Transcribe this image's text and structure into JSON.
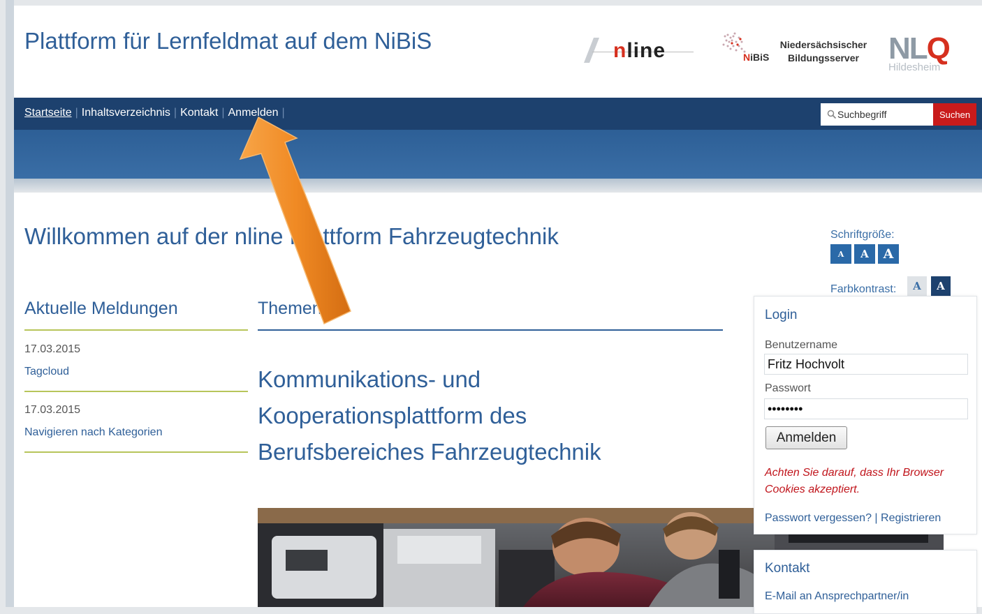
{
  "header": {
    "site_title": "Plattform für Lernfeldmat auf dem NiBiS",
    "logos": {
      "nline": "nline",
      "nibis": "NiBiS",
      "nds_line1": "Niedersächsischer",
      "nds_line2": "Bildungsserver",
      "nlq": "NLQ",
      "nlq_sub": "Hildesheim"
    }
  },
  "nav": {
    "items": [
      "Startseite",
      "Inhaltsverzeichnis",
      "Kontakt",
      "Anmelden"
    ],
    "search_placeholder": "Suchbegriff",
    "search_button": "Suchen"
  },
  "main": {
    "welcome": "Willkommen auf der nline Plattform Fahrzeugtechnik",
    "themes_heading": "Themen",
    "themes_text_line1": "Kommunikations- und",
    "themes_text_line2": "Kooperationsplattform des",
    "themes_text_line3": "Berufsbereiches Fahrzeugtechnik"
  },
  "news": {
    "heading": "Aktuelle Meldungen",
    "items": [
      {
        "date": "17.03.2015",
        "title": "Tagcloud"
      },
      {
        "date": "17.03.2015",
        "title": "Navigieren nach Kategorien"
      }
    ]
  },
  "accessibility": {
    "font_size_label": "Schriftgröße:",
    "font_buttons": [
      "A",
      "A",
      "A"
    ],
    "contrast_label": "Farbkontrast:",
    "contrast_buttons": [
      "A",
      "A"
    ]
  },
  "login": {
    "title": "Login",
    "username_label": "Benutzername",
    "username_value": "Fritz Hochvolt",
    "password_label": "Passwort",
    "password_value": "abcdefgh",
    "button": "Anmelden",
    "cookie_note": "Achten Sie darauf, dass Ihr Browser Cookies akzeptiert.",
    "forgot_link": "Passwort vergessen?",
    "separator": "|",
    "register_link": "Registrieren"
  },
  "contact": {
    "title": "Kontakt",
    "link": "E-Mail an Ansprechpartner/in"
  },
  "colors": {
    "navbar": "#1d416e",
    "accent_blue": "#2f5f98",
    "search_button": "#c91b1b",
    "arrow": "#f08a24"
  }
}
